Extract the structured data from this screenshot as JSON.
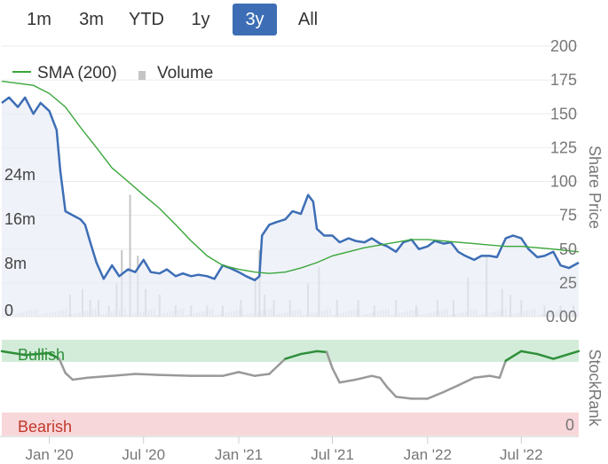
{
  "range_selector": {
    "buttons": [
      {
        "label": "1m",
        "active": false
      },
      {
        "label": "3m",
        "active": false
      },
      {
        "label": "YTD",
        "active": false
      },
      {
        "label": "1y",
        "active": false
      },
      {
        "label": "3y",
        "active": true
      },
      {
        "label": "All",
        "active": false
      }
    ]
  },
  "legend": {
    "sma_label": "SMA (200)",
    "volume_label": "Volume"
  },
  "colors": {
    "price": "#3d6eb5",
    "price_fill": "#e8edf6",
    "sma": "#3aa63a",
    "volume": "#c4c4c4",
    "bullish_band": "#d3ecd9",
    "bearish_band": "#f8d7da",
    "bearish_text": "#c0392b",
    "stockrank_bull": "#2f8f3a",
    "stockrank_neutral": "#999999",
    "active_button": "#3d6eb5"
  },
  "chart_data": [
    {
      "type": "line",
      "panel": "price",
      "y_axis_title": "Share Price",
      "y_ticks": [
        "200",
        "175",
        "150",
        "125",
        "100",
        "75",
        "50",
        "25",
        "0.00"
      ],
      "ylim": [
        0,
        200
      ],
      "x_ticks": [
        "Jan '20",
        "Jul '20",
        "Jan '21",
        "Jul '21",
        "Jan '22",
        "Jul '22"
      ],
      "xlim": [
        "2019-10-01",
        "2022-10-20"
      ],
      "series": [
        {
          "kind": "price",
          "x": [
            "2019-10-01",
            "2019-10-15",
            "2019-11-01",
            "2019-11-15",
            "2019-12-01",
            "2019-12-15",
            "2020-01-01",
            "2020-01-15",
            "2020-01-22",
            "2020-02-01",
            "2020-02-15",
            "2020-03-01",
            "2020-03-10",
            "2020-03-20",
            "2020-04-01",
            "2020-04-15",
            "2020-05-01",
            "2020-05-15",
            "2020-06-01",
            "2020-06-15",
            "2020-07-01",
            "2020-07-15",
            "2020-08-01",
            "2020-08-15",
            "2020-09-01",
            "2020-09-15",
            "2020-10-01",
            "2020-10-15",
            "2020-11-01",
            "2020-11-15",
            "2020-12-01",
            "2020-12-15",
            "2021-01-01",
            "2021-01-15",
            "2021-02-01",
            "2021-02-10",
            "2021-02-15",
            "2021-03-01",
            "2021-03-15",
            "2021-04-01",
            "2021-04-15",
            "2021-05-01",
            "2021-05-15",
            "2021-05-25",
            "2021-06-01",
            "2021-06-15",
            "2021-07-01",
            "2021-07-15",
            "2021-08-01",
            "2021-08-15",
            "2021-09-01",
            "2021-09-15",
            "2021-10-01",
            "2021-10-15",
            "2021-11-01",
            "2021-11-15",
            "2021-12-01",
            "2021-12-15",
            "2022-01-01",
            "2022-01-15",
            "2022-02-01",
            "2022-02-15",
            "2022-03-01",
            "2022-03-15",
            "2022-04-01",
            "2022-04-15",
            "2022-05-01",
            "2022-05-15",
            "2022-06-01",
            "2022-06-15",
            "2022-07-01",
            "2022-07-15",
            "2022-08-01",
            "2022-08-15",
            "2022-09-01",
            "2022-09-15",
            "2022-10-01",
            "2022-10-20"
          ],
          "y": [
            158,
            162,
            155,
            162,
            150,
            158,
            152,
            138,
            108,
            78,
            75,
            72,
            68,
            55,
            40,
            28,
            38,
            30,
            35,
            33,
            42,
            33,
            32,
            35,
            30,
            32,
            30,
            31,
            30,
            28,
            38,
            36,
            33,
            30,
            27,
            30,
            60,
            68,
            70,
            72,
            78,
            76,
            90,
            85,
            65,
            60,
            60,
            55,
            58,
            56,
            55,
            58,
            54,
            52,
            48,
            55,
            57,
            50,
            52,
            56,
            54,
            55,
            48,
            45,
            42,
            45,
            45,
            44,
            58,
            60,
            58,
            50,
            44,
            45,
            48,
            38,
            36,
            40
          ]
        },
        {
          "kind": "sma",
          "name": "SMA (200)",
          "x": [
            "2019-10-01",
            "2019-12-01",
            "2020-01-01",
            "2020-02-01",
            "2020-03-01",
            "2020-04-01",
            "2020-05-01",
            "2020-06-01",
            "2020-07-01",
            "2020-08-01",
            "2020-09-01",
            "2020-10-01",
            "2020-11-01",
            "2020-12-01",
            "2021-01-01",
            "2021-02-01",
            "2021-03-01",
            "2021-04-01",
            "2021-05-01",
            "2021-06-01",
            "2021-07-01",
            "2021-08-01",
            "2021-09-01",
            "2021-10-01",
            "2021-11-01",
            "2021-12-01",
            "2022-01-01",
            "2022-02-01",
            "2022-03-01",
            "2022-04-01",
            "2022-05-01",
            "2022-06-01",
            "2022-07-01",
            "2022-08-01",
            "2022-09-01",
            "2022-10-20"
          ],
          "y": [
            174,
            171,
            165,
            155,
            140,
            125,
            110,
            100,
            90,
            80,
            68,
            56,
            45,
            38,
            35,
            33,
            32,
            33,
            36,
            40,
            45,
            48,
            51,
            53,
            55,
            57,
            57,
            56,
            55,
            54,
            53,
            52,
            52,
            51,
            50,
            48
          ]
        },
        {
          "kind": "volume",
          "name": "Volume",
          "axis_ticks": [
            "24m",
            "16m",
            "8m",
            "0"
          ],
          "ylim": [
            0,
            32
          ],
          "x": [
            "2020-02-10",
            "2020-03-05",
            "2020-03-20",
            "2020-04-05",
            "2020-04-25",
            "2020-05-10",
            "2020-05-20",
            "2020-06-05",
            "2020-06-20",
            "2020-07-05",
            "2020-08-01",
            "2020-09-01",
            "2020-10-01",
            "2020-11-01",
            "2020-12-01",
            "2021-01-05",
            "2021-02-02",
            "2021-02-10",
            "2021-02-20",
            "2021-03-10",
            "2021-04-10",
            "2021-05-15",
            "2021-06-05",
            "2021-07-10",
            "2021-08-20",
            "2021-09-20",
            "2021-11-01",
            "2021-12-10",
            "2022-01-20",
            "2022-02-20",
            "2022-03-20",
            "2022-04-25",
            "2022-05-25",
            "2022-06-10",
            "2022-07-01",
            "2022-08-15",
            "2022-09-15",
            "2022-10-10"
          ],
          "y": [
            4,
            5,
            3,
            3,
            2,
            6,
            12,
            22,
            11,
            5,
            4,
            2,
            2,
            2,
            2,
            3,
            7,
            12,
            4,
            3,
            3,
            6,
            9,
            3,
            3,
            2,
            3,
            2,
            3,
            3,
            7,
            11,
            5,
            4,
            3,
            2,
            2,
            2
          ]
        }
      ]
    },
    {
      "type": "line",
      "panel": "stockrank",
      "y_axis_title": "StockRank",
      "zones": [
        {
          "label": "Bullish",
          "range": [
            70,
            100
          ]
        },
        {
          "label": "Bearish",
          "range": [
            0,
            30
          ]
        }
      ],
      "y_ticks": [
        "0"
      ],
      "ylim": [
        0,
        100
      ],
      "x": [
        "2019-10-01",
        "2019-11-15",
        "2020-01-01",
        "2020-01-20",
        "2020-02-01",
        "2020-02-15",
        "2020-03-15",
        "2020-05-01",
        "2020-06-15",
        "2020-08-01",
        "2020-10-01",
        "2020-12-01",
        "2021-01-01",
        "2021-02-01",
        "2021-03-01",
        "2021-04-01",
        "2021-05-01",
        "2021-06-01",
        "2021-06-20",
        "2021-07-01",
        "2021-07-15",
        "2021-08-15",
        "2021-09-15",
        "2021-10-01",
        "2021-10-15",
        "2021-11-01",
        "2021-12-01",
        "2022-01-01",
        "2022-02-01",
        "2022-03-01",
        "2022-04-01",
        "2022-05-01",
        "2022-05-20",
        "2022-06-01",
        "2022-07-01",
        "2022-08-01",
        "2022-09-01",
        "2022-10-20"
      ],
      "y": [
        88,
        84,
        86,
        80,
        65,
        58,
        60,
        62,
        64,
        63,
        62,
        62,
        66,
        62,
        64,
        80,
        85,
        88,
        87,
        70,
        55,
        58,
        62,
        60,
        50,
        40,
        38,
        38,
        45,
        52,
        60,
        62,
        60,
        78,
        88,
        85,
        80,
        88
      ]
    }
  ]
}
